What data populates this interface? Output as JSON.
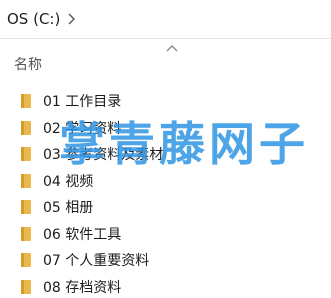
{
  "breadcrumb": {
    "drive_label": "OS (C:)"
  },
  "header": {
    "name_column": "名称",
    "sort_direction": "ascending"
  },
  "folders": [
    {
      "label": "01 工作目录"
    },
    {
      "label": "02 学习资料"
    },
    {
      "label": "03 参考资料及素材"
    },
    {
      "label": "04 视频"
    },
    {
      "label": "05 相册"
    },
    {
      "label": "06 软件工具"
    },
    {
      "label": "07 个人重要资料"
    },
    {
      "label": "08 存档资料"
    }
  ],
  "watermark": {
    "text": "掌青藤网子"
  },
  "colors": {
    "folder": "#e8b84a",
    "folder_dark": "#d39c2c",
    "watermark": "#2f95e3"
  },
  "icons": {
    "crumb_separator": "chevron-right-icon",
    "sort": "chevron-up-icon",
    "folder": "folder-icon"
  }
}
